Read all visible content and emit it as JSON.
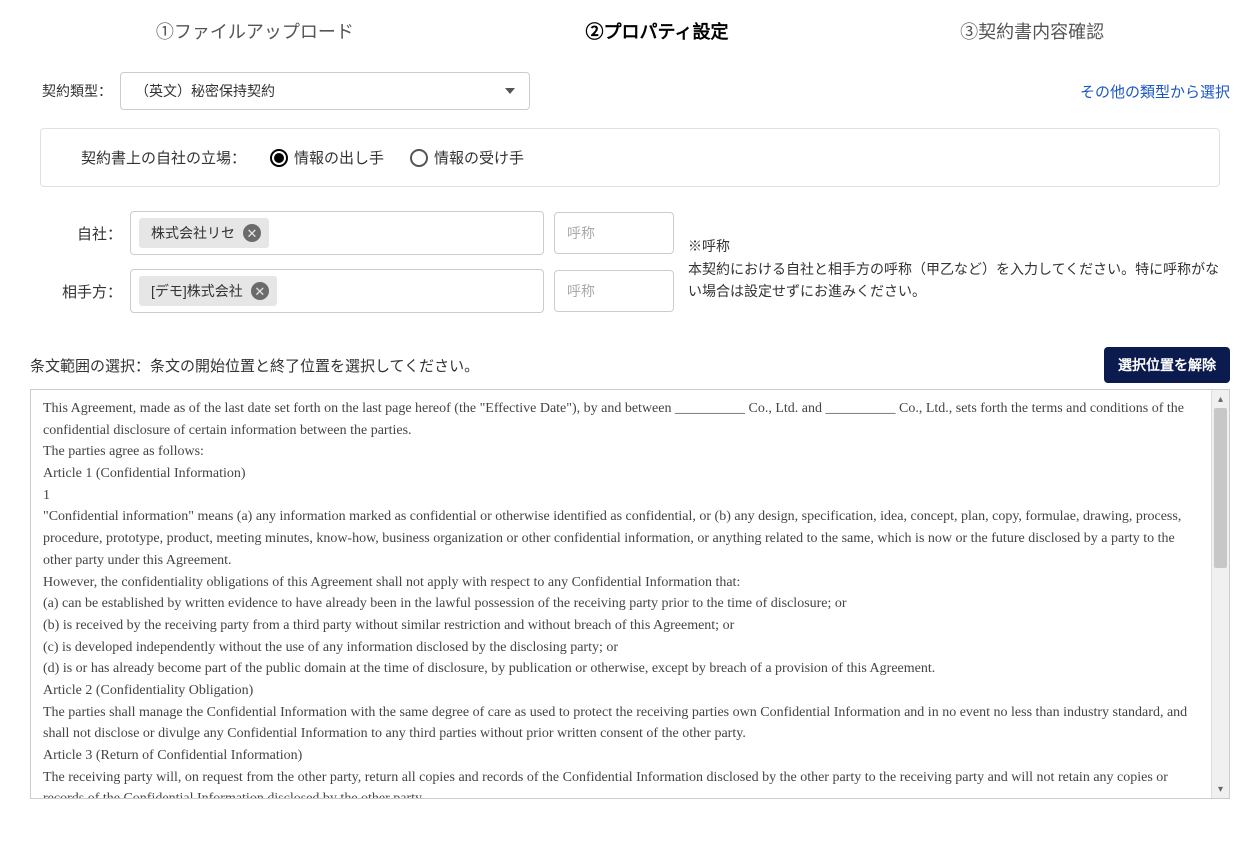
{
  "steps": {
    "s1": "①ファイルアップロード",
    "s2": "②プロパティ設定",
    "s3": "③契約書内容確認"
  },
  "contractType": {
    "label": "契約類型：",
    "value": "（英文）秘密保持契約",
    "otherLink": "その他の類型から選択"
  },
  "position": {
    "label": "契約書上の自社の立場：",
    "option1": "情報の出し手",
    "option2": "情報の受け手"
  },
  "ownParty": {
    "label": "自社：",
    "tag": "株式会社リセ",
    "aliasPlaceholder": "呼称"
  },
  "otherParty": {
    "label": "相手方：",
    "tag": "[デモ]株式会社",
    "aliasPlaceholder": "呼称"
  },
  "help": {
    "title": "※呼称",
    "body": "本契約における自社と相手方の呼称（甲乙など）を入力してください。特に呼称がない場合は設定せずにお進みください。"
  },
  "range": {
    "label": "条文範囲の選択：条文の開始位置と終了位置を選択してください。",
    "clearBtn": "選択位置を解除"
  },
  "document": "This Agreement, made as of the last date set forth on the last page hereof (the \"Effective Date\"), by and between __________ Co., Ltd. and __________ Co., Ltd., sets forth the terms and conditions of the confidential disclosure of certain information between the parties.\nThe parties agree as follows:\nArticle 1 (Confidential Information)\n1\n\"Confidential information\" means (a) any information marked as confidential or otherwise identified as confidential, or (b) any design, specification, idea, concept, plan, copy, formulae, drawing, process, procedure, prototype, product, meeting minutes, know-how, business organization or other confidential information, or anything related to the same, which is now or the future disclosed by a party to the other party under this Agreement.\nHowever, the confidentiality obligations of this Agreement shall not apply with respect to any Confidential Information that:\n(a) can be established by written evidence to have already been in the lawful possession of the receiving party prior to the time of disclosure; or\n(b) is received by the receiving party from a third party without similar restriction and without breach of this Agreement; or\n(c) is developed independently without the use of any information disclosed by the disclosing party; or\n(d) is or has already become part of the public domain at the time of disclosure, by publication or otherwise, except by breach of a provision of this Agreement.\nArticle 2 (Confidentiality Obligation)\nThe parties shall manage the Confidential Information with the same degree of care as used to protect the receiving parties own Confidential Information and in no event no less than industry standard, and shall not disclose or divulge any Confidential Information to any third parties without prior written consent of the other party.\nArticle 3 (Return of Confidential Information)\nThe receiving party will, on request from the other party, return all copies and records of the Confidential Information disclosed by the other party to the receiving party and will not retain any copies or records of the Confidential Information disclosed by the other party."
}
